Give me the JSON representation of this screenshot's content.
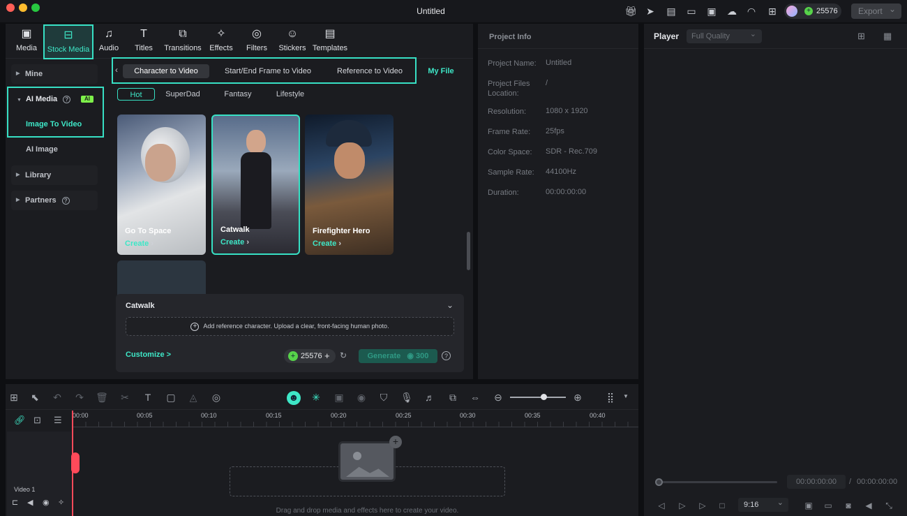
{
  "window": {
    "title": "Untitled"
  },
  "header": {
    "credits": "25576",
    "export_label": "Export",
    "export_caret": "⌄"
  },
  "nav": [
    {
      "label": "Media",
      "icon": "media-icon",
      "glyph": "▣"
    },
    {
      "label": "Stock Media",
      "icon": "stock-media-icon",
      "glyph": "⊟"
    },
    {
      "label": "Audio",
      "icon": "music-note-icon",
      "glyph": "♫"
    },
    {
      "label": "Titles",
      "icon": "text-t-icon",
      "glyph": "T"
    },
    {
      "label": "Transitions",
      "icon": "transitions-icon",
      "glyph": "⧉"
    },
    {
      "label": "Effects",
      "icon": "effects-sparkle-icon",
      "glyph": "✧"
    },
    {
      "label": "Filters",
      "icon": "filters-icon",
      "glyph": "◎"
    },
    {
      "label": "Stickers",
      "icon": "stickers-icon",
      "glyph": "☺"
    },
    {
      "label": "Templates",
      "icon": "templates-icon",
      "glyph": "▤"
    }
  ],
  "sidebar": {
    "mine": "Mine",
    "ai_media": "AI Media",
    "ai_badge": "AI",
    "image_to_video": "Image To Video",
    "ai_image": "AI Image",
    "library": "Library",
    "partners": "Partners"
  },
  "subtabs": [
    "Character to Video",
    "Start/End Frame to Video",
    "Reference to Video"
  ],
  "my_file": "My File",
  "chips": [
    "Hot",
    "SuperDad",
    "Fantasy",
    "Lifestyle"
  ],
  "cards": [
    {
      "title": "Go To Space",
      "action": "Create"
    },
    {
      "title": "Catwalk",
      "action": "Create"
    },
    {
      "title": "Firefighter Hero",
      "action": "Create"
    }
  ],
  "generate": {
    "title": "Catwalk",
    "upload_hint": "Add reference character. Upload a clear, front-facing human photo.",
    "customize": "Customize >",
    "credits": "25576",
    "generate_label": "Generate",
    "cost": "300"
  },
  "project_info": {
    "header": "Project Info",
    "rows": [
      {
        "k": "Project Name:",
        "v": "Untitled"
      },
      {
        "k": "Project Files Location:",
        "v": "/"
      },
      {
        "k": "Resolution:",
        "v": "1080 x 1920"
      },
      {
        "k": "Frame Rate:",
        "v": "25fps"
      },
      {
        "k": "Color Space:",
        "v": "SDR - Rec.709"
      },
      {
        "k": "Sample Rate:",
        "v": "44100Hz"
      },
      {
        "k": "Duration:",
        "v": "00:00:00:00"
      }
    ]
  },
  "player": {
    "label": "Player",
    "quality": "Full Quality",
    "current_time": "00:00:00:00",
    "separator": "/",
    "total_time": "00:00:00:00",
    "ratio": "9:16",
    "progress": 0
  },
  "timeline": {
    "ruler": [
      "00:00",
      "00:05",
      "00:10",
      "00:15",
      "00:20",
      "00:25",
      "00:30",
      "00:35",
      "00:40"
    ],
    "track_label": "Video 1",
    "drop_text": "Drag and drop media and effects here to create your video."
  }
}
